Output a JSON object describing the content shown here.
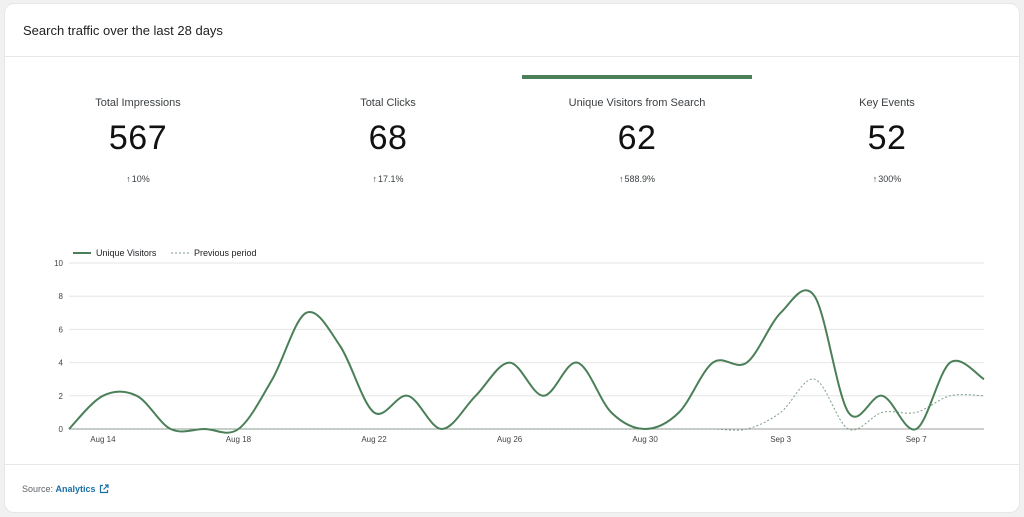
{
  "card": {
    "title": "Search traffic over the last 28 days"
  },
  "metrics": [
    {
      "label": "Total Impressions",
      "value": "567",
      "change": "10%",
      "selected": false
    },
    {
      "label": "Total Clicks",
      "value": "68",
      "change": "17.1%",
      "selected": false
    },
    {
      "label": "Unique Visitors from Search",
      "value": "62",
      "change": "588.9%",
      "selected": true
    },
    {
      "label": "Key Events",
      "value": "52",
      "change": "300%",
      "selected": false
    }
  ],
  "footer": {
    "source_label": "Source:",
    "source_link": "Analytics",
    "icon": "external-link-icon"
  },
  "colors": {
    "accent": "#4a7f58",
    "previous": "#7a9e85",
    "grid": "#e6e6e6"
  },
  "chart_data": {
    "type": "line",
    "legend_placement": "top-left",
    "grid": true,
    "ylim": [
      0,
      10
    ],
    "yticks": [
      0,
      2,
      4,
      6,
      8,
      10
    ],
    "x_ticks": [
      {
        "label": "Aug 14",
        "index": 1
      },
      {
        "label": "Aug 18",
        "index": 5
      },
      {
        "label": "Aug 22",
        "index": 9
      },
      {
        "label": "Aug 26",
        "index": 13
      },
      {
        "label": "Aug 30",
        "index": 17
      },
      {
        "label": "Sep 3",
        "index": 21
      },
      {
        "label": "Sep 7",
        "index": 25
      }
    ],
    "series": [
      {
        "name": "Unique Visitors",
        "style": "solid",
        "values": [
          0,
          2,
          2,
          0,
          0,
          0,
          3,
          7,
          5,
          1,
          2,
          0,
          2,
          4,
          2,
          4,
          1,
          0,
          1,
          4,
          4,
          7,
          8,
          1,
          2,
          0,
          4,
          3
        ]
      },
      {
        "name": "Previous period",
        "style": "dashed",
        "values": [
          0,
          0,
          0,
          0,
          0,
          0,
          0,
          0,
          0,
          0,
          0,
          0,
          0,
          0,
          0,
          0,
          0,
          0,
          0,
          0,
          0,
          1,
          3,
          0,
          1,
          1,
          2,
          2
        ]
      }
    ]
  }
}
